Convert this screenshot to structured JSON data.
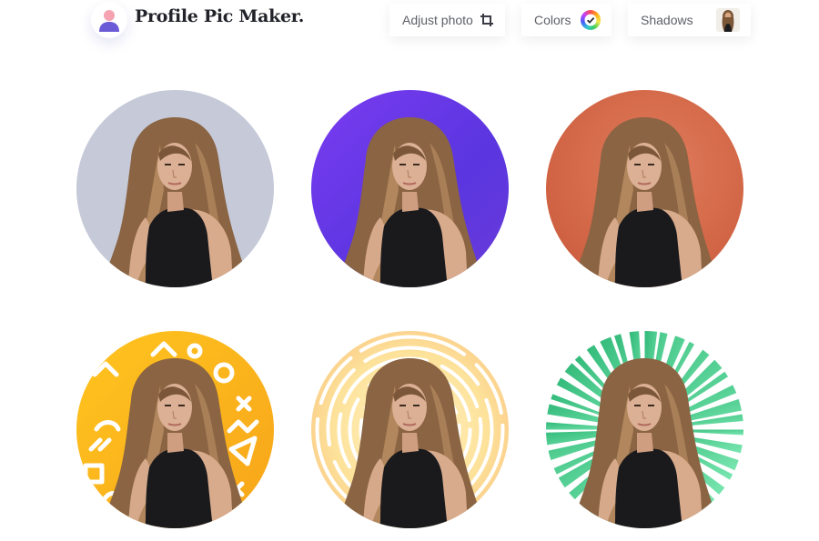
{
  "app": {
    "title": "Profile Pic Maker",
    "title_dot": "."
  },
  "toolbar": {
    "adjust_label": "Adjust photo",
    "colors_label": "Colors",
    "shadows_label": "Shadows"
  },
  "icons": {
    "logo": "user-avatar-icon",
    "adjust": "crop-icon",
    "colors": "color-wheel-check-icon",
    "shadows": "portrait-thumbnail-icon"
  },
  "colors": {
    "accent_purple": "#6a3cec",
    "gray_bg": "#c5c9d8",
    "orange_bg": "#cf6242",
    "yellow_bg": "#f9b21d",
    "green_stripes": "#3ec98a"
  },
  "gallery": {
    "styles": [
      "gray",
      "purple",
      "orange",
      "yellow-shapes",
      "yellow-rings",
      "green-rays"
    ]
  }
}
